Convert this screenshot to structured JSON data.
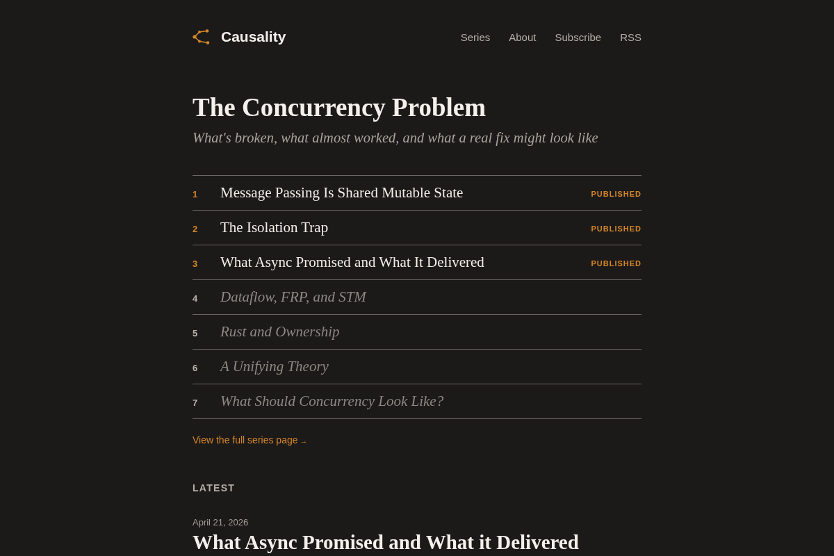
{
  "header": {
    "logo_text": "Causality",
    "nav": [
      "Series",
      "About",
      "Subscribe",
      "RSS"
    ]
  },
  "series": {
    "title": "The Concurrency Problem",
    "subtitle": "What's broken, what almost worked, and what a real fix might look like",
    "parts": [
      {
        "number": "1",
        "title": "Message Passing Is Shared Mutable State",
        "published": true,
        "status": "PUBLISHED"
      },
      {
        "number": "2",
        "title": "The Isolation Trap",
        "published": true,
        "status": "PUBLISHED"
      },
      {
        "number": "3",
        "title": "What Async Promised and What It Delivered",
        "published": true,
        "status": "PUBLISHED"
      },
      {
        "number": "4",
        "title": "Dataflow, FRP, and STM",
        "published": false
      },
      {
        "number": "5",
        "title": "Rust and Ownership",
        "published": false
      },
      {
        "number": "6",
        "title": "A Unifying Theory",
        "published": false
      },
      {
        "number": "7",
        "title": "What Should Concurrency Look Like?",
        "published": false
      }
    ],
    "link": {
      "label": "View the full series page",
      "arrow": "→"
    }
  },
  "latest": {
    "heading": "LATEST",
    "posts": [
      {
        "date": "April 21, 2026",
        "title": "What Async Promised and What it Delivered"
      }
    ]
  }
}
